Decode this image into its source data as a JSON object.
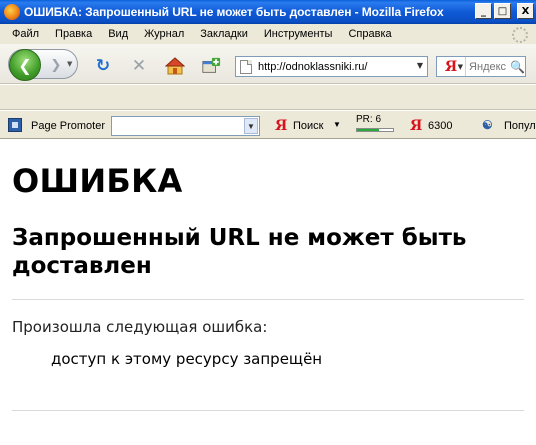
{
  "window": {
    "title": "ОШИБКА: Запрошенный URL не может быть доставлен - Mozilla Firefox",
    "minimize": "_",
    "maximize": "□",
    "close": "X"
  },
  "menu": {
    "items": [
      "Файл",
      "Правка",
      "Вид",
      "Журнал",
      "Закладки",
      "Инструменты",
      "Справка"
    ]
  },
  "navbar": {
    "back_icon": "back-arrow-icon",
    "forward_icon": "forward-arrow-icon",
    "reload_icon": "reload-icon",
    "stop_icon": "stop-icon",
    "home_icon": "home-icon",
    "addon_icon": "add-bookmark-icon",
    "url": "http://odnoklassniki.ru/",
    "search_engine": "Я",
    "search_placeholder": "Яндекс"
  },
  "page_promoter": {
    "label": "Page Promoter",
    "combo_value": "",
    "yandex_logo": "Я",
    "search_label": "Поиск",
    "pr_label": "PR: 6",
    "pr_value": 0.6,
    "count": "6300",
    "popular_label": "Попул"
  },
  "content": {
    "heading": "ОШИБКА",
    "subheading": "Запрошенный URL не может быть доставлен",
    "error_intro": "Произошла следующая ошибка:",
    "error_detail": "доступ к этому ресурсу запрещён"
  },
  "colors": {
    "titlebar": "#0a5fd8",
    "chrome": "#ece9d8",
    "yandex_red": "#d8121c",
    "pr_green": "#2aa83a"
  }
}
